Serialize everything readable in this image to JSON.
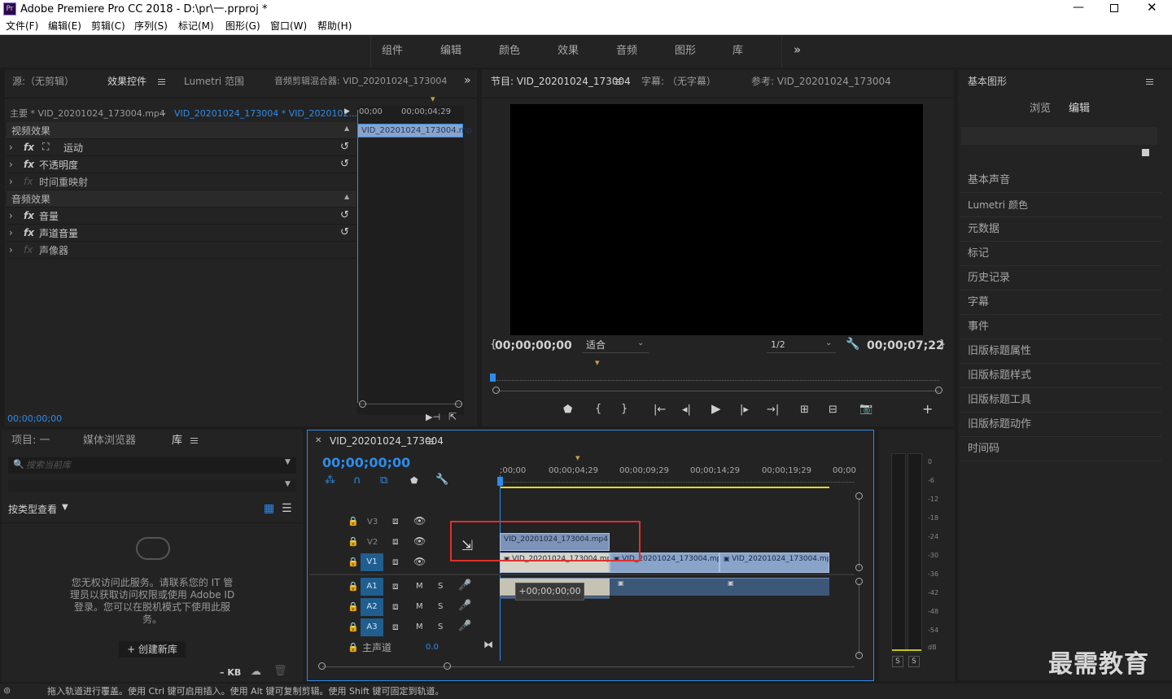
{
  "window": {
    "app_icon": "Pr",
    "title": "Adobe Premiere Pro CC 2018 - D:\\pr\\一.prproj *",
    "controls": [
      "minimize-icon",
      "maximize-icon",
      "close-icon"
    ]
  },
  "menu": [
    "文件(F)",
    "编辑(E)",
    "剪辑(C)",
    "序列(S)",
    "标记(M)",
    "图形(G)",
    "窗口(W)",
    "帮助(H)"
  ],
  "workspaces": {
    "items": [
      "组件",
      "编辑",
      "颜色",
      "效果",
      "音频",
      "图形",
      "库"
    ],
    "more": "»"
  },
  "source_panel": {
    "tabs": [
      "源:（无剪辑）",
      "效果控件",
      "Lumetri 范围",
      "音频剪辑混合器: VID_20201024_173004"
    ],
    "active_tab": "效果控件",
    "more": "»",
    "master_label": "主要 * VID_20201024_173004.mp4",
    "seq_label": "VID_20201024_173004 * VID_2020102...",
    "ruler": {
      "start": "00;00",
      "end": "00;00;04;29"
    },
    "clip_label": "VID_20201024_173004.mp",
    "video_effects_header": "视频效果",
    "video_effects": [
      "运动",
      "不透明度",
      "时间重映射"
    ],
    "audio_effects_header": "音频效果",
    "audio_effects": [
      "音量",
      "声道音量",
      "声像器"
    ],
    "fx_label": "fx",
    "timecode": "00;00;00;00"
  },
  "program_panel": {
    "tabs": [
      "节目: VID_20201024_173004",
      "字幕: （无字幕）",
      "参考: VID_20201024_173004"
    ],
    "active_tab": "节目: VID_20201024_173004",
    "timecode_left": "00;00;00;00",
    "zoom": "适合",
    "resolution": "1/2",
    "timecode_right": "00;00;07;22"
  },
  "essential_graphics": {
    "title": "基本图形",
    "tabs": [
      "浏览",
      "编辑"
    ],
    "active_tab": "编辑",
    "panels": [
      "基本声音",
      "Lumetri 颜色",
      "元数据",
      "标记",
      "历史记录",
      "字幕",
      "事件",
      "旧版标题属性",
      "旧版标题样式",
      "旧版标题工具",
      "旧版标题动作",
      "时间码"
    ]
  },
  "project_panel": {
    "tabs": [
      "项目: 一",
      "媒体浏览器",
      "库"
    ],
    "active_tab": "库",
    "search_placeholder": "搜索当前库",
    "view_by": "按类型查看",
    "message": "您无权访问此服务。请联系您的 IT 管理员以获取访问权限或使用 Adobe ID 登录。您可以在脱机模式下使用此服务。",
    "create_button": "+ 创建新库",
    "size": "– KB"
  },
  "timeline": {
    "title": "VID_20201024_173004",
    "timecode": "00;00;00;00",
    "ruler": [
      ";00;00",
      "00;00;04;29",
      "00;00;09;29",
      "00;00;14;29",
      "00;00;19;29",
      "00;00"
    ],
    "video_tracks": [
      "V3",
      "V2",
      "V1"
    ],
    "audio_tracks": [
      "A1",
      "A2",
      "A3"
    ],
    "master": {
      "label": "主声道",
      "value": "0.0"
    },
    "mute": "M",
    "solo": "S",
    "clips": {
      "v2_dragging": "VID_20201024_173004.mp4",
      "v1": [
        "VID_20201024_173004.mp4",
        "VID_20201024_173004.mp4",
        "VID_20201024_173004.mp4"
      ]
    },
    "drag_tooltip": "+00;00;00;00"
  },
  "audio_meter": {
    "scale": [
      "0",
      "-6",
      "-12",
      "-18",
      "-24",
      "-30",
      "-36",
      "-42",
      "-48",
      "-54",
      "dB"
    ],
    "solo": [
      "S",
      "S"
    ]
  },
  "status_bar": {
    "text": "拖入轨道进行覆盖。使用 Ctrl 键可启用插入。使用 Alt 键可复制剪辑。使用 Shift 键可固定到轨道。"
  },
  "watermark": "最需教育",
  "colors": {
    "accent": "#2d8ceb",
    "highlight_box": "#e0302b",
    "clip_video": "#8aa3c9",
    "clip_audio": "#3c5778",
    "work_area": "#e6d81f"
  }
}
